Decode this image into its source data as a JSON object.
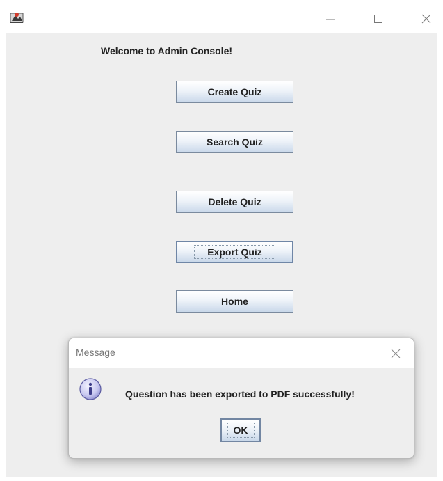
{
  "window": {
    "icon": "java-app-icon",
    "controls": {
      "minimize": "minimize-icon",
      "maximize": "maximize-icon",
      "close": "close-icon"
    }
  },
  "main": {
    "welcome_text": "Welcome to Admin Console!",
    "buttons": {
      "create": "Create Quiz",
      "search": "Search Quiz",
      "delete": "Delete Quiz",
      "export": "Export Quiz",
      "home": "Home"
    }
  },
  "dialog": {
    "title": "Message",
    "icon": "info-icon",
    "message": "Question has been exported to PDF successfully!",
    "ok_label": "OK"
  },
  "colors": {
    "panel_background": "#eeeeee",
    "button_border": "#7a8a9e",
    "button_gradient_bottom": "#c9d8ea",
    "info_icon_fill": "#c8c8f0"
  }
}
